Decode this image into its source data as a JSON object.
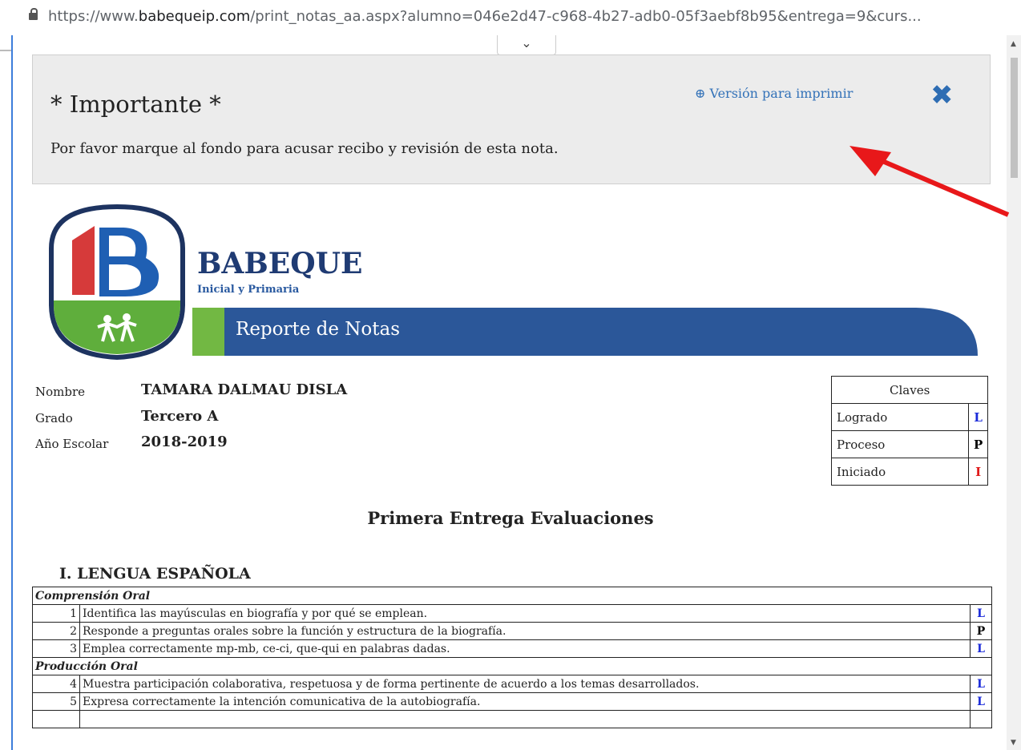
{
  "browser": {
    "url_prefix": "https://www.",
    "url_host": "babequeip.com",
    "url_path": "/print_notas_aa.aspx?alumno=046e2d47-c968-4b27-adb0-05f3aebf8b95&entrega=9&curs..."
  },
  "notice": {
    "title": "* Importante *",
    "message": "Por favor marque al fondo para acusar recibo y revisión de esta nota.",
    "print_link": "Versión para imprimir",
    "close_icon": "close-icon"
  },
  "header": {
    "brand": "BABEQUE",
    "subtitle": "Inicial y Primaria",
    "banner": "Reporte de Notas"
  },
  "student": {
    "name_label": "Nombre",
    "name": "TAMARA DALMAU DISLA",
    "grade_label": "Grado",
    "grade": "Tercero A",
    "year_label": "Año Escolar",
    "year": "2018-2019"
  },
  "claves": {
    "title": "Claves",
    "items": [
      {
        "label": "Logrado",
        "code": "L"
      },
      {
        "label": "Proceso",
        "code": "P"
      },
      {
        "label": "Iniciado",
        "code": "I"
      }
    ]
  },
  "report_title": "Primera Entrega Evaluaciones",
  "subject": "I. LENGUA ESPAÑOLA",
  "sections": [
    {
      "title": "Comprensión Oral",
      "rows": [
        {
          "n": "1",
          "text": "Identifica las mayúsculas en biografía y por qué se emplean.",
          "code": "L"
        },
        {
          "n": "2",
          "text": "Responde a preguntas orales sobre la función y estructura de la biografía.",
          "code": "P"
        },
        {
          "n": "3",
          "text": "Emplea correctamente mp-mb, ce-ci, que-qui en palabras dadas.",
          "code": "L"
        }
      ]
    },
    {
      "title": "Producción Oral",
      "rows": [
        {
          "n": "4",
          "text": "Muestra participación colaborativa, respetuosa y de forma pertinente de acuerdo a los temas desarrollados.",
          "code": "L"
        },
        {
          "n": "5",
          "text": "Expresa correctamente la intención comunicativa de la autobiografía.",
          "code": "L"
        }
      ]
    }
  ]
}
